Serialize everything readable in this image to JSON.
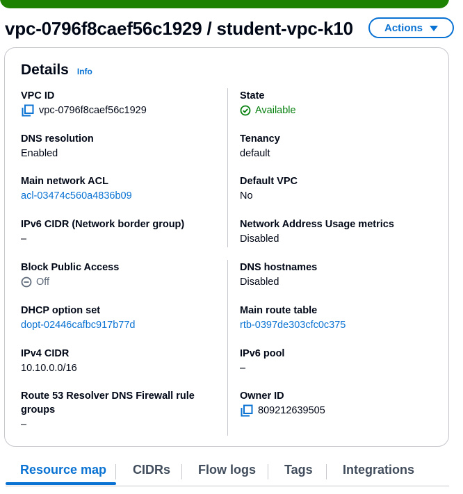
{
  "header": {
    "title": "vpc-0796f8caef56c1929 / student-vpc-k10",
    "actions_label": "Actions"
  },
  "details": {
    "title": "Details",
    "info_label": "Info",
    "vpc_id": {
      "label": "VPC ID",
      "value": "vpc-0796f8caef56c1929"
    },
    "state": {
      "label": "State",
      "value": "Available"
    },
    "dns_resolution": {
      "label": "DNS resolution",
      "value": "Enabled"
    },
    "tenancy": {
      "label": "Tenancy",
      "value": "default"
    },
    "main_network_acl": {
      "label": "Main network ACL",
      "value": "acl-03474c560a4836b09"
    },
    "default_vpc": {
      "label": "Default VPC",
      "value": "No"
    },
    "ipv6_cidr": {
      "label": "IPv6 CIDR (Network border group)",
      "value": "–"
    },
    "nau_metrics": {
      "label": "Network Address Usage metrics",
      "value": "Disabled"
    },
    "block_public_access": {
      "label": "Block Public Access",
      "value": "Off"
    },
    "dns_hostnames": {
      "label": "DNS hostnames",
      "value": "Disabled"
    },
    "dhcp_option_set": {
      "label": "DHCP option set",
      "value": "dopt-02446cafbc917b77d"
    },
    "main_route_table": {
      "label": "Main route table",
      "value": "rtb-0397de303cfc0c375"
    },
    "ipv4_cidr": {
      "label": "IPv4 CIDR",
      "value": "10.10.0.0/16"
    },
    "ipv6_pool": {
      "label": "IPv6 pool",
      "value": "–"
    },
    "route53_resolver": {
      "label_line1": "Route 53 Resolver DNS Firewall rule",
      "label_line2": "groups",
      "value": "–"
    },
    "owner_id": {
      "label": "Owner ID",
      "value": "809212639505"
    }
  },
  "tabs": [
    {
      "label": "Resource map",
      "active": true
    },
    {
      "label": "CIDRs",
      "active": false
    },
    {
      "label": "Flow logs",
      "active": false
    },
    {
      "label": "Tags",
      "active": false
    },
    {
      "label": "Integrations",
      "active": false
    }
  ],
  "colors": {
    "accent": "#0972d3",
    "success": "#037f0c",
    "flash": "#1d8102",
    "border": "#c6c6cd"
  },
  "icons": {
    "copy": "copy-icon",
    "status_available": "status-positive-icon",
    "status_off": "status-stopped-icon",
    "dropdown": "caret-down-icon"
  }
}
